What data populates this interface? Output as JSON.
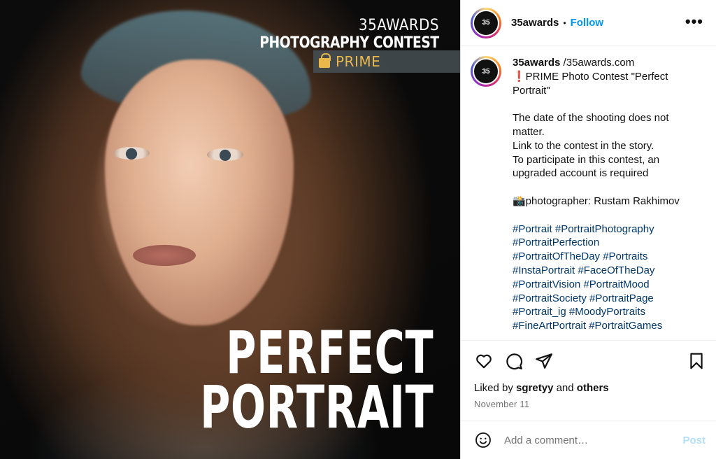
{
  "media": {
    "brand_line1": "35AWARDS",
    "brand_line2": "PHOTOGRAPHY CONTEST",
    "prime_label": "PRIME",
    "title_line1": "PERFECT",
    "title_line2": "PORTRAIT"
  },
  "post": {
    "username": "35awards",
    "follow_label": "Follow",
    "more_label": "•••"
  },
  "caption": {
    "username": "35awards",
    "url": " /35awards.com",
    "lines": [
      "❗PRIME Photo Contest \"Perfect",
      "Portrait\"",
      "",
      "The date of the shooting does not",
      "matter.",
      "Link to the contest in the story.",
      "To participate in this contest, an",
      "upgraded account is required",
      "",
      "📸photographer: Rustam Rakhimov",
      ""
    ],
    "hashtags": [
      "#Portrait #PortraitPhotography",
      "#PortraitPerfection",
      "#PortraitOfTheDay #Portraits",
      "#InstaPortrait #FaceOfTheDay",
      "#PortraitVision #PortraitMood",
      "#PortraitSociety #PortraitPage",
      "#Portrait_ig #MoodyPortraits",
      "#FineArtPortrait #PortraitGames"
    ]
  },
  "likes": {
    "prefix": "Liked by ",
    "user": "sgretyy",
    "middle": " and ",
    "others": "others"
  },
  "date": "November 11",
  "comment": {
    "placeholder": "Add a comment…",
    "post_label": "Post"
  },
  "icons": {
    "like": "heart-icon",
    "comment": "comment-bubble-icon",
    "share": "paper-plane-icon",
    "save": "bookmark-icon",
    "emoji": "smiley-icon"
  }
}
